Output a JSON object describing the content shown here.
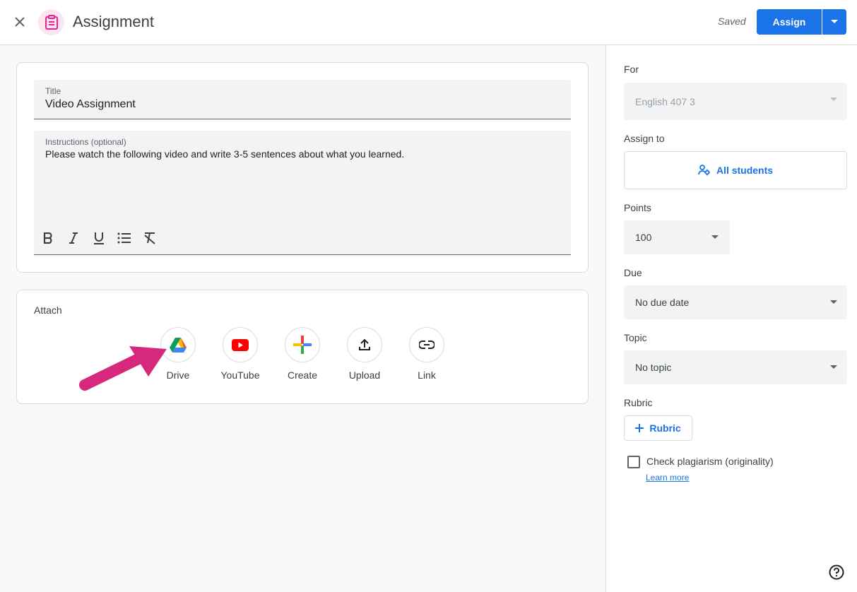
{
  "header": {
    "title": "Assignment",
    "saved_text": "Saved",
    "assign_label": "Assign"
  },
  "main": {
    "title_label": "Title",
    "title_value": "Video Assignment",
    "instructions_label": "Instructions (optional)",
    "instructions_value": "Please watch the following video and write 3-5 sentences about what you learned."
  },
  "attach": {
    "label": "Attach",
    "items": [
      {
        "label": "Drive",
        "icon": "google-drive-icon"
      },
      {
        "label": "YouTube",
        "icon": "youtube-icon"
      },
      {
        "label": "Create",
        "icon": "plus-icon"
      },
      {
        "label": "Upload",
        "icon": "upload-icon"
      },
      {
        "label": "Link",
        "icon": "link-icon"
      }
    ]
  },
  "side": {
    "for_label": "For",
    "for_value": "English 407 3",
    "assign_to_label": "Assign to",
    "assign_to_value": "All students",
    "points_label": "Points",
    "points_value": "100",
    "due_label": "Due",
    "due_value": "No due date",
    "topic_label": "Topic",
    "topic_value": "No topic",
    "rubric_label": "Rubric",
    "rubric_button": "Rubric",
    "plagiarism_label": "Check plagiarism (originality)",
    "learn_more": "Learn more"
  },
  "colors": {
    "accent": "#1a73e8",
    "assignment_icon": "#e52592",
    "annotation_arrow": "#d6297d"
  }
}
